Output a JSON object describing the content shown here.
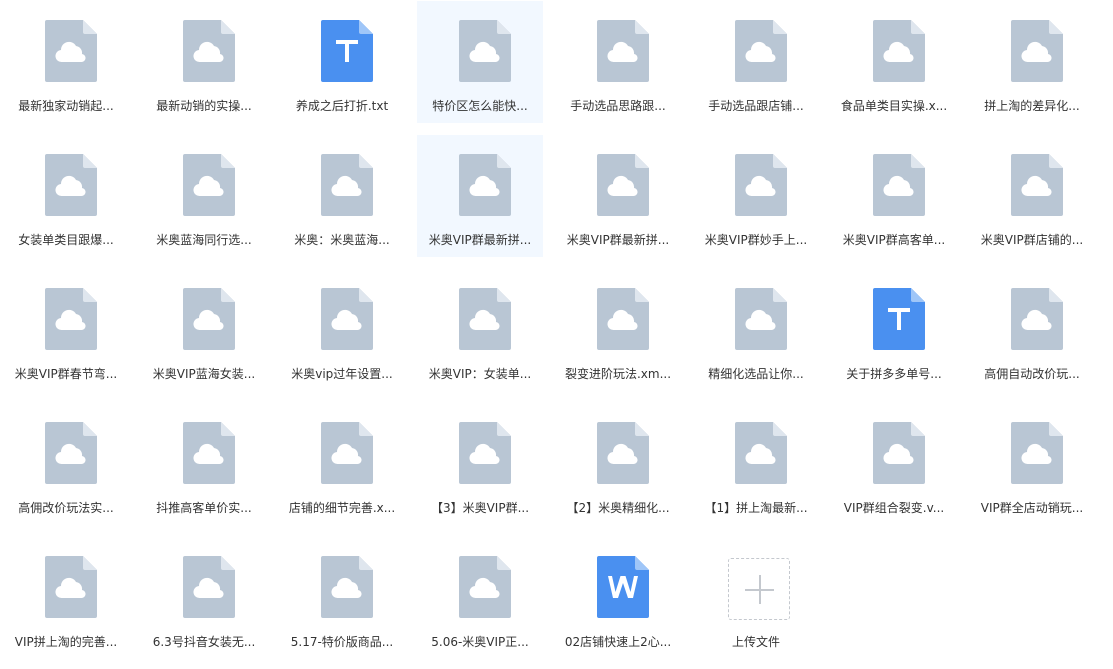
{
  "files": [
    {
      "name": "最新独家动销起...",
      "icon": "cloud-file-icon",
      "selected": false
    },
    {
      "name": "最新动销的实操...",
      "icon": "cloud-file-icon",
      "selected": false
    },
    {
      "name": "养成之后打折.txt",
      "icon": "text-file-icon",
      "selected": false
    },
    {
      "name": "特价区怎么能快...",
      "icon": "cloud-file-icon",
      "selected": true
    },
    {
      "name": "手动选品思路跟...",
      "icon": "cloud-file-icon",
      "selected": false
    },
    {
      "name": "手动选品跟店铺...",
      "icon": "cloud-file-icon",
      "selected": false
    },
    {
      "name": "食品单类目实操.x...",
      "icon": "cloud-file-icon",
      "selected": false
    },
    {
      "name": "拼上淘的差异化...",
      "icon": "cloud-file-icon",
      "selected": false
    },
    {
      "name": "女装单类目跟爆...",
      "icon": "cloud-file-icon",
      "selected": false
    },
    {
      "name": "米奥蓝海同行选...",
      "icon": "cloud-file-icon",
      "selected": false
    },
    {
      "name": "米奥：米奥蓝海...",
      "icon": "cloud-file-icon",
      "selected": false
    },
    {
      "name": "米奥VIP群最新拼...",
      "icon": "cloud-file-icon",
      "selected": true
    },
    {
      "name": "米奥VIP群最新拼...",
      "icon": "cloud-file-icon",
      "selected": false
    },
    {
      "name": "米奥VIP群妙手上...",
      "icon": "cloud-file-icon",
      "selected": false
    },
    {
      "name": "米奥VIP群高客单...",
      "icon": "cloud-file-icon",
      "selected": false
    },
    {
      "name": "米奥VIP群店铺的...",
      "icon": "cloud-file-icon",
      "selected": false
    },
    {
      "name": "米奥VIP群春节弯...",
      "icon": "cloud-file-icon",
      "selected": false
    },
    {
      "name": "米奥VIP蓝海女装...",
      "icon": "cloud-file-icon",
      "selected": false
    },
    {
      "name": "米奥vip过年设置...",
      "icon": "cloud-file-icon",
      "selected": false
    },
    {
      "name": "米奥VIP：女装单...",
      "icon": "cloud-file-icon",
      "selected": false
    },
    {
      "name": "裂变进阶玩法.xm...",
      "icon": "cloud-file-icon",
      "selected": false
    },
    {
      "name": "精细化选品让你...",
      "icon": "cloud-file-icon",
      "selected": false
    },
    {
      "name": "关于拼多多单号...",
      "icon": "text-file-icon",
      "selected": false
    },
    {
      "name": "高佣自动改价玩...",
      "icon": "cloud-file-icon",
      "selected": false
    },
    {
      "name": "高佣改价玩法实...",
      "icon": "cloud-file-icon",
      "selected": false
    },
    {
      "name": "抖推高客单价实...",
      "icon": "cloud-file-icon",
      "selected": false
    },
    {
      "name": "店铺的细节完善.x...",
      "icon": "cloud-file-icon",
      "selected": false
    },
    {
      "name": "【3】米奥VIP群...",
      "icon": "cloud-file-icon",
      "selected": false
    },
    {
      "name": "【2】米奥精细化...",
      "icon": "cloud-file-icon",
      "selected": false
    },
    {
      "name": "【1】拼上淘最新...",
      "icon": "cloud-file-icon",
      "selected": false
    },
    {
      "name": "VIP群组合裂变.v...",
      "icon": "cloud-file-icon",
      "selected": false
    },
    {
      "name": "VIP群全店动销玩...",
      "icon": "cloud-file-icon",
      "selected": false
    },
    {
      "name": "VIP拼上淘的完善...",
      "icon": "cloud-file-icon",
      "selected": false
    },
    {
      "name": "6.3号抖音女装无...",
      "icon": "cloud-file-icon",
      "selected": false
    },
    {
      "name": "5.17-特价版商品...",
      "icon": "cloud-file-icon",
      "selected": false
    },
    {
      "name": "5.06-米奥VIP正...",
      "icon": "cloud-file-icon",
      "selected": false
    },
    {
      "name": "02店铺快速上2心...",
      "icon": "word-file-icon",
      "selected": false
    }
  ],
  "upload": {
    "label": "上传文件",
    "icon": "plus-icon"
  },
  "colors": {
    "cloud_file": "#b9c6d4",
    "cloud_fold": "#dfe6ee",
    "blue_file": "#4a90f0",
    "blue_fold": "#9fc6f8",
    "selected_bg": "#f2f8ff"
  }
}
